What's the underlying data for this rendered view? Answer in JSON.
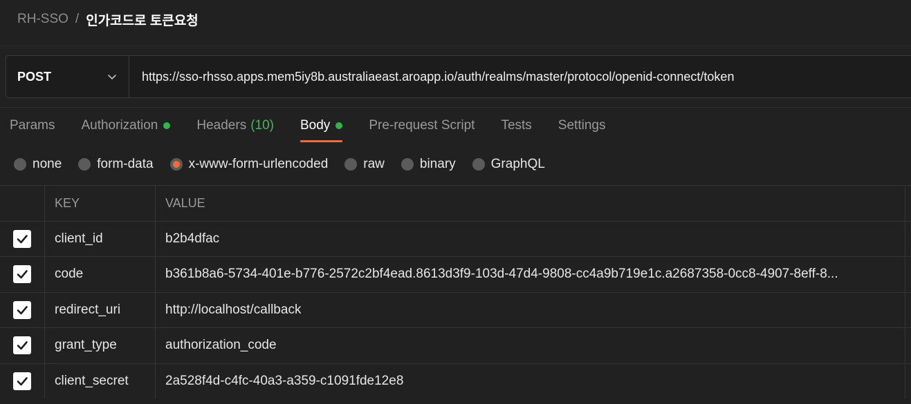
{
  "breadcrumb": {
    "parent": "RH-SSO",
    "separator": "/",
    "current": "인가코드로 토큰요청"
  },
  "request": {
    "method": "POST",
    "url": "https://sso-rhsso.apps.mem5iy8b.australiaeast.aroapp.io/auth/realms/master/protocol/openid-connect/token"
  },
  "tabs": [
    {
      "label": "Params"
    },
    {
      "label": "Authorization",
      "dot": true
    },
    {
      "label": "Headers",
      "count": "(10)"
    },
    {
      "label": "Body",
      "dot": true,
      "active": true
    },
    {
      "label": "Pre-request Script"
    },
    {
      "label": "Tests"
    },
    {
      "label": "Settings"
    }
  ],
  "body_types": [
    {
      "label": "none"
    },
    {
      "label": "form-data"
    },
    {
      "label": "x-www-form-urlencoded",
      "selected": true
    },
    {
      "label": "raw"
    },
    {
      "label": "binary"
    },
    {
      "label": "GraphQL"
    }
  ],
  "table": {
    "key_header": "KEY",
    "value_header": "VALUE",
    "rows": [
      {
        "key": "client_id",
        "value": "b2b4dfac",
        "checked": true
      },
      {
        "key": "code",
        "value": "b361b8a6-5734-401e-b776-2572c2bf4ead.8613d3f9-103d-47d4-9808-cc4a9b719e1c.a2687358-0cc8-4907-8eff-8...",
        "checked": true
      },
      {
        "key": "redirect_uri",
        "value": "http://localhost/callback",
        "checked": true
      },
      {
        "key": "grant_type",
        "value": "authorization_code",
        "checked": true
      },
      {
        "key": "client_secret",
        "value": "2a528f4d-c4fc-40a3-a359-c1091fde12e8",
        "checked": true
      }
    ]
  },
  "colors": {
    "accent": "#f26b3a",
    "status_green": "#2fb54a",
    "background": "#212121"
  },
  "icons": {
    "method_dropdown": "chevron-down-icon",
    "row_check": "checkbox-checked-icon"
  }
}
